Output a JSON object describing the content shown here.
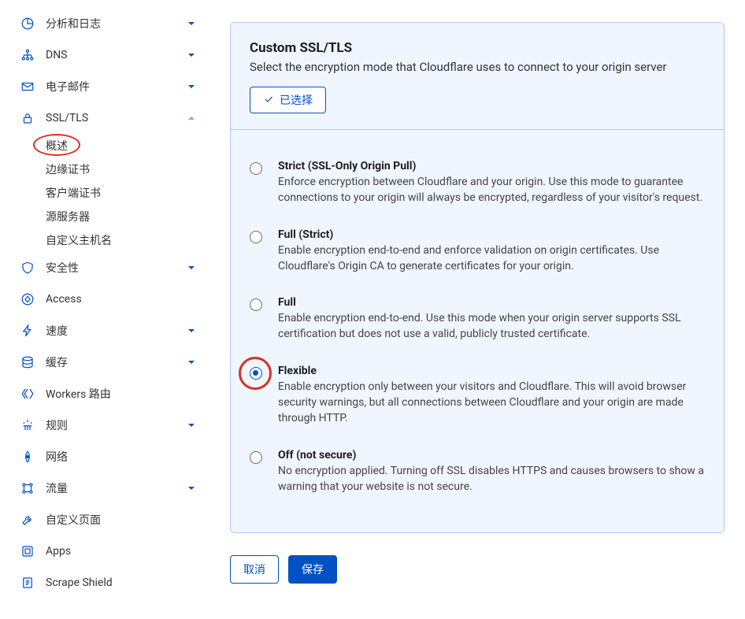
{
  "sidebar": {
    "items": [
      {
        "icon": "chart-icon",
        "label": "分析和日志",
        "expandable": true,
        "expanded": false
      },
      {
        "icon": "dns-icon",
        "label": "DNS",
        "expandable": true,
        "expanded": false
      },
      {
        "icon": "mail-icon",
        "label": "电子邮件",
        "expandable": true,
        "expanded": false
      },
      {
        "icon": "lock-icon",
        "label": "SSL/TLS",
        "expandable": true,
        "expanded": true,
        "children": [
          {
            "label": "概述",
            "highlighted": true
          },
          {
            "label": "边缘证书"
          },
          {
            "label": "客户端证书"
          },
          {
            "label": "源服务器"
          },
          {
            "label": "自定义主机名"
          }
        ]
      },
      {
        "icon": "shield-icon",
        "label": "安全性",
        "expandable": true,
        "expanded": false
      },
      {
        "icon": "access-icon",
        "label": "Access",
        "expandable": false
      },
      {
        "icon": "bolt-icon",
        "label": "速度",
        "expandable": true,
        "expanded": false
      },
      {
        "icon": "cache-icon",
        "label": "缓存",
        "expandable": true,
        "expanded": false
      },
      {
        "icon": "workers-icon",
        "label": "Workers 路由",
        "expandable": false
      },
      {
        "icon": "rules-icon",
        "label": "规则",
        "expandable": true,
        "expanded": false
      },
      {
        "icon": "network-icon",
        "label": "网络",
        "expandable": false
      },
      {
        "icon": "traffic-icon",
        "label": "流量",
        "expandable": true,
        "expanded": false
      },
      {
        "icon": "wrench-icon",
        "label": "自定义页面",
        "expandable": false
      },
      {
        "icon": "apps-icon",
        "label": "Apps",
        "expandable": false
      },
      {
        "icon": "scrape-icon",
        "label": "Scrape Shield",
        "expandable": false
      }
    ]
  },
  "panel": {
    "title": "Custom SSL/TLS",
    "subtitle": "Select the encryption mode that Cloudflare uses to connect to your origin server",
    "selected_label": "已选择",
    "options": [
      {
        "title": "Strict (SSL-Only Origin Pull)",
        "desc": "Enforce encryption between Cloudflare and your origin. Use this mode to guarantee connections to your origin will always be encrypted, regardless of your visitor's request.",
        "checked": false
      },
      {
        "title": "Full (Strict)",
        "desc": "Enable encryption end-to-end and enforce validation on origin certificates. Use Cloudflare's Origin CA to generate certificates for your origin.",
        "checked": false
      },
      {
        "title": "Full",
        "desc": "Enable encryption end-to-end. Use this mode when your origin server supports SSL certification but does not use a valid, publicly trusted certificate.",
        "checked": false
      },
      {
        "title": "Flexible",
        "desc": "Enable encryption only between your visitors and Cloudflare. This will avoid browser security warnings, but all connections between Cloudflare and your origin are made through HTTP.",
        "checked": true,
        "annotated": true
      },
      {
        "title": "Off (not secure)",
        "desc": "No encryption applied. Turning off SSL disables HTTPS and causes browsers to show a warning that your website is not secure.",
        "checked": false
      }
    ]
  },
  "footer": {
    "cancel": "取消",
    "save": "保存"
  }
}
